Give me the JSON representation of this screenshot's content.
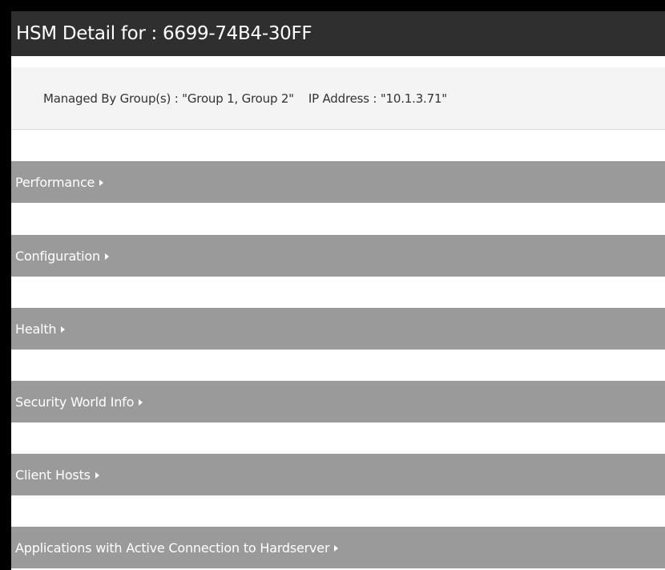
{
  "header": {
    "title": "HSM Detail for : 6699-74B4-30FF"
  },
  "info": {
    "managed_by": "Managed By Group(s) : \"Group 1, Group 2\"",
    "ip_address": "IP Address : \"10.1.3.71\""
  },
  "sections": [
    {
      "label": "Performance"
    },
    {
      "label": "Configuration"
    },
    {
      "label": "Health"
    },
    {
      "label": "Security World Info"
    },
    {
      "label": "Client Hosts"
    },
    {
      "label": "Applications with Active Connection to Hardserver"
    }
  ],
  "icons": {
    "expand": "caret-right-icon"
  },
  "colors": {
    "title_bar": "#2f2f2f",
    "section_bar": "#9a9a9a",
    "info_strip": "#f4f4f4"
  }
}
